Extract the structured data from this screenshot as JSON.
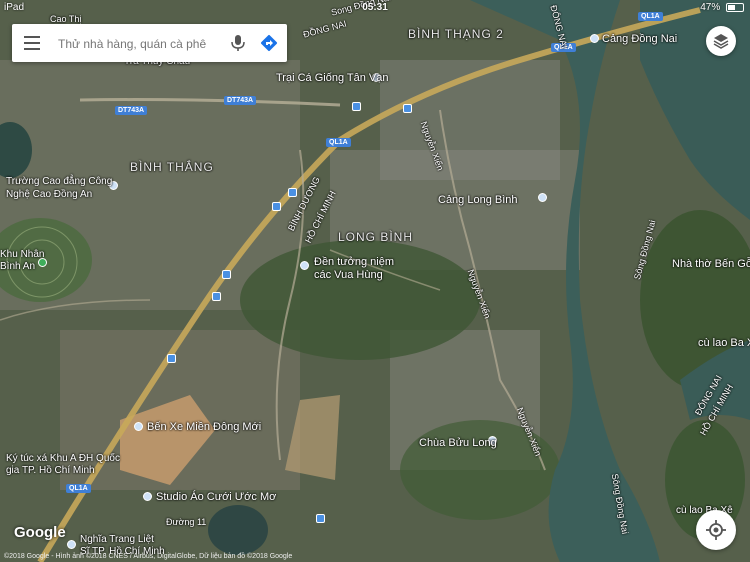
{
  "status_bar": {
    "device": "iPad",
    "time": "05:31",
    "battery": "47%",
    "battery_level": 0.47
  },
  "search": {
    "placeholder": "Thử nhà hàng, quán cà phê"
  },
  "map": {
    "districts": [
      "BÌNH THẮNG",
      "BÌNH THẠNG 2",
      "LONG BÌNH",
      "BÌNH DƯƠNG"
    ],
    "places": [
      "Cảng Đồng Nai",
      "Trại Cá Giống Tân Vạn",
      "Trường Cao đẳng Công",
      "Nghệ Cao Đồng An",
      "Cảng Long Bình",
      "Đền tưởng niệm",
      "các Vua Hùng",
      "Nhà thờ Bến Gỗ",
      "cù lao Ba Xê",
      "Bến Xe Miền Đông Mới",
      "Chùa Bửu Long",
      "Ký túc xá Khu A ĐH Quốc",
      "gia TP. Hồ Chí Minh",
      "Studio Áo Cưới Ước Mơ",
      "Nghĩa Trang Liệt",
      "Sĩ TP. Hồ Chí Minh",
      "cù lao Ba Xê",
      "Khu Nhân",
      "Bình An",
      "Cao Thị",
      "Trà Thủy Châu",
      "Song Đồng Nai",
      "Đường 11"
    ],
    "roads": [
      "QL1A",
      "DT743A",
      "DT743A",
      "QL1A",
      "QL1A",
      "QL1A"
    ],
    "streets": [
      "HỒ CHÍ MINH",
      "Nguyễn Xiển",
      "Nguyễn Xiển",
      "Nguyễn Xiển",
      "ĐÔNG NAI",
      "HỒ CHÍ MINH",
      "ĐỒNG NAI",
      "Sông Đồng Nai",
      "Sông Đồng Nai",
      "ĐÔNG NAI"
    ],
    "attribution": "©2018 Google - Hình ảnh ©2018 CNES / Airbus, DigitalGlobe, Dữ liệu bản đồ ©2018 Google",
    "logo": "Google"
  },
  "colors": {
    "accent": "#4a90e2",
    "river": "#3c5f5a",
    "land": "#4a5a3e"
  }
}
